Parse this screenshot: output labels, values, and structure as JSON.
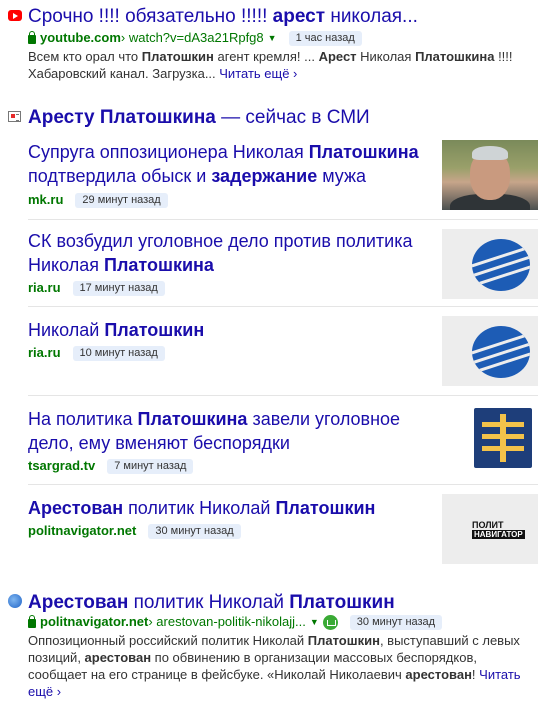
{
  "result1": {
    "icon": "youtube-icon",
    "title_pre": "Срочно !!!! обязательно !!!!! ",
    "title_bold": "арест",
    "title_post": " николая...",
    "domain": "youtube.com",
    "path": " › watch?v=dA3a21Rpfg8",
    "time": "1 час назад",
    "snippet_line1_a": "Всем кто орал что ",
    "snippet_line1_b": "Платошкин",
    "snippet_line1_c": " агент кремля! ... ",
    "snippet_line1_d": "Арест",
    "snippet_line1_e": " Николая ",
    "snippet_line1_f": "Платошкина",
    "snippet_line1_g": " !!!!",
    "snippet_line2": "Хабаровский канал. Загрузка... ",
    "more": "Читать ещё ›"
  },
  "news": {
    "icon": "news-icon",
    "header_bold": "Аресту Платошкина",
    "header_rest": " — сейчас в СМИ",
    "items": [
      {
        "t1": "Супруга оппозиционера Николая ",
        "t2": "Платошкина",
        "t3": " подтвердила обыск и ",
        "t4": "задержание",
        "t5": " мужа",
        "source": "mk.ru",
        "time": "29 минут назад"
      },
      {
        "t1": "СК возбудил уголовное дело против политика Николая ",
        "t2": "Платошкина",
        "source": "ria.ru",
        "time": "17 минут назад"
      },
      {
        "t1": "Николай ",
        "t2": "Платошкин",
        "source": "ria.ru",
        "time": "10 минут назад"
      },
      {
        "t1": "На политика ",
        "t2": "Платошкина",
        "t3": " завели уголовное дело, ему вменяют беспорядки",
        "source": "tsargrad.tv",
        "time": "7 минут назад"
      },
      {
        "t1": "Арестован",
        "t2": " политик Николай ",
        "t3": "Платошкин",
        "source": "politnavigator.net",
        "time": "30 минут назад",
        "logo_line1": "ПОЛИТ",
        "logo_line2": "НАВИГАТОР"
      }
    ]
  },
  "result2": {
    "icon": "globe-icon",
    "title_bold1": "Арестован",
    "title_mid": " политик Николай ",
    "title_bold2": "Платошкин",
    "domain": "politnavigator.net",
    "path": " › arestovan-politik-nikolajj...",
    "time": "30 минут назад",
    "s1": "Оппозиционный российский политик Николай ",
    "s2": "Платошкин",
    "s3": ", выступавший с левых позиций, ",
    "s4": "арестован",
    "s5": " по обвинению в организации массовых беспорядков, сообщает на его странице в фейсбуке. «Николай Николаевич ",
    "s6": "арестован",
    "s7": "! ",
    "more": "Читать ещё ›"
  }
}
